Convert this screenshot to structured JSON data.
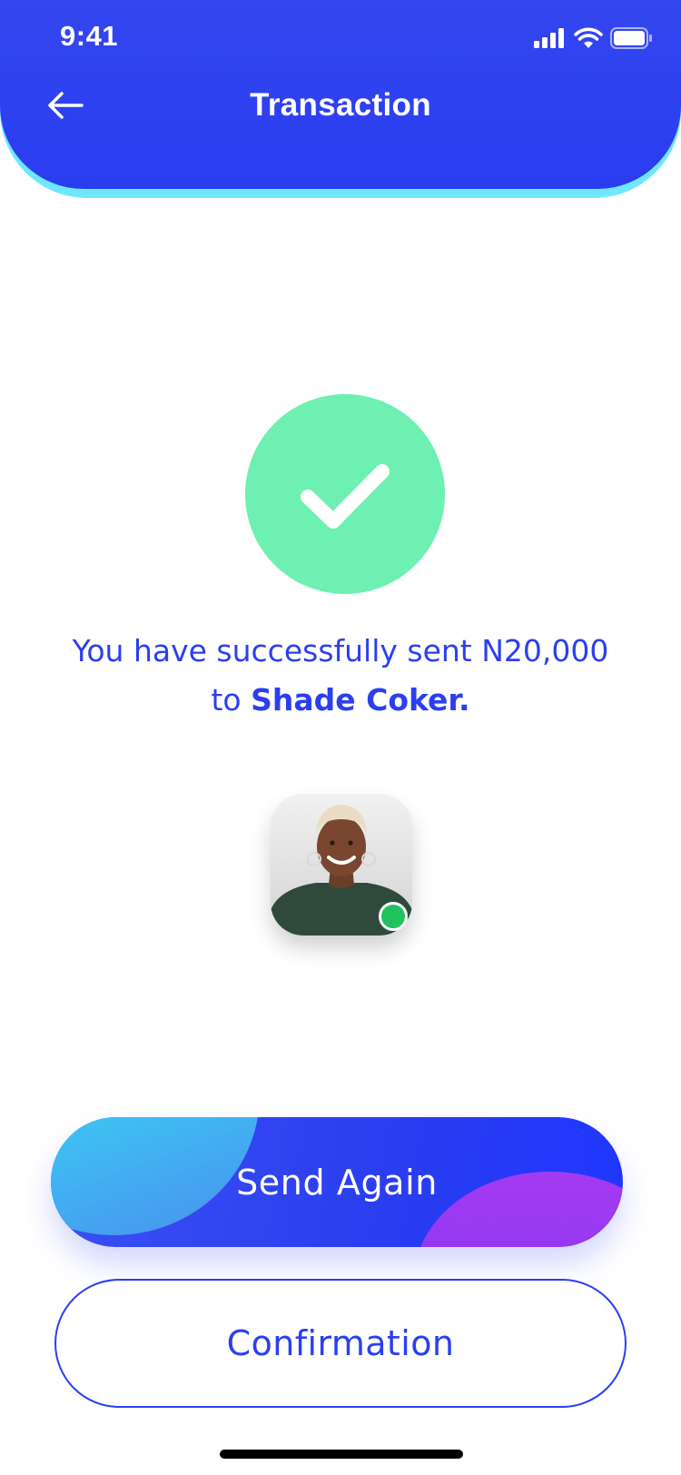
{
  "status_bar": {
    "time": "9:41"
  },
  "header": {
    "title": "Transaction",
    "back_icon": "arrow-left-icon"
  },
  "success": {
    "icon": "checkmark-icon",
    "message_prefix": "You have successfully sent N20,000 to",
    "recipient": "Shade Coker."
  },
  "recipient_avatar": {
    "online": true,
    "online_color": "#21c15e"
  },
  "actions": {
    "primary_label": "Send Again",
    "secondary_label": "Confirmation"
  },
  "colors": {
    "primary": "#2b3ff0",
    "header": "#3346ef",
    "success": "#6df0b1",
    "accent_cyan": "#36e6f2",
    "accent_purple": "#a43af2"
  }
}
